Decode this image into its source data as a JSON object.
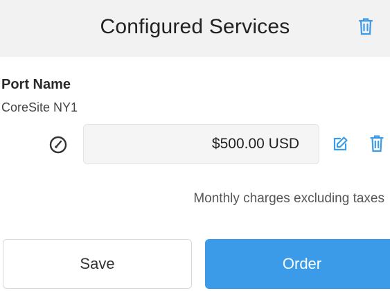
{
  "header": {
    "title": "Configured Services",
    "trash_icon": "trash-icon"
  },
  "port": {
    "label": "Port Name",
    "value": "CoreSite NY1"
  },
  "pricing": {
    "gauge_icon": "gauge-icon",
    "price": "$500.00 USD",
    "edit_icon": "edit-icon",
    "trash_icon": "trash-icon",
    "note": "Monthly charges excluding taxes"
  },
  "actions": {
    "save_label": "Save",
    "order_label": "Order"
  },
  "colors": {
    "accent": "#3b9be8",
    "header_bg": "#f2f2f2"
  }
}
